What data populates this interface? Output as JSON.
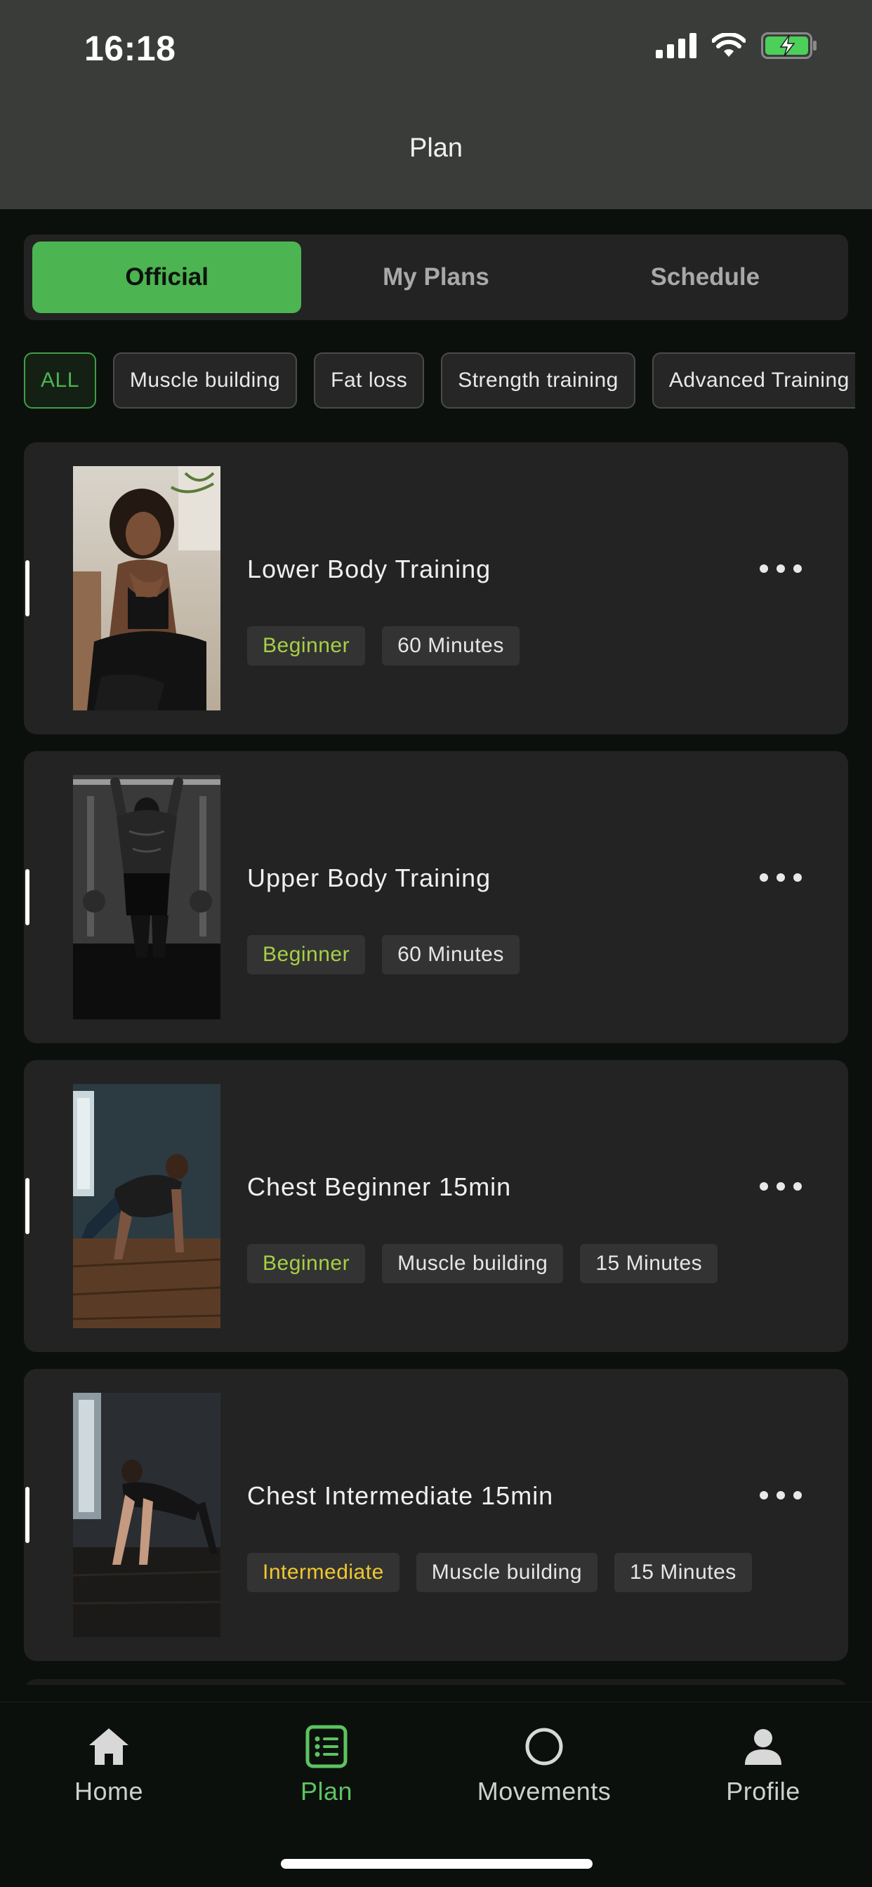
{
  "status_bar": {
    "time": "16:18"
  },
  "header": {
    "title": "Plan"
  },
  "segments": [
    {
      "label": "Official",
      "active": true
    },
    {
      "label": "My Plans",
      "active": false
    },
    {
      "label": "Schedule",
      "active": false
    }
  ],
  "filters": [
    {
      "label": "ALL",
      "active": true
    },
    {
      "label": "Muscle building",
      "active": false
    },
    {
      "label": "Fat loss",
      "active": false
    },
    {
      "label": "Strength training",
      "active": false
    },
    {
      "label": "Advanced Training",
      "active": false
    }
  ],
  "plans": [
    {
      "title": "Lower Body Training",
      "tags": [
        {
          "text": "Beginner",
          "kind": "beginner"
        },
        {
          "text": "60 Minutes",
          "kind": "plain"
        }
      ]
    },
    {
      "title": "Upper Body Training",
      "tags": [
        {
          "text": "Beginner",
          "kind": "beginner"
        },
        {
          "text": "60 Minutes",
          "kind": "plain"
        }
      ]
    },
    {
      "title": "Chest Beginner 15min",
      "tags": [
        {
          "text": "Beginner",
          "kind": "beginner"
        },
        {
          "text": "Muscle building",
          "kind": "plain"
        },
        {
          "text": "15 Minutes",
          "kind": "plain"
        }
      ]
    },
    {
      "title": "Chest Intermediate 15min",
      "tags": [
        {
          "text": "Intermediate",
          "kind": "intermediate"
        },
        {
          "text": "Muscle building",
          "kind": "plain"
        },
        {
          "text": "15 Minutes",
          "kind": "plain"
        }
      ]
    }
  ],
  "tabbar": [
    {
      "label": "Home",
      "icon": "home-icon",
      "active": false
    },
    {
      "label": "Plan",
      "icon": "plan-list-icon",
      "active": true
    },
    {
      "label": "Movements",
      "icon": "movements-circle-icon",
      "active": false
    },
    {
      "label": "Profile",
      "icon": "profile-icon",
      "active": false
    }
  ],
  "colors": {
    "accent": "#4cb451",
    "beginner": "#a6cf46",
    "intermediate": "#f0c830",
    "card": "#232323",
    "background": "#0c100c",
    "header": "#3a3c3a"
  }
}
